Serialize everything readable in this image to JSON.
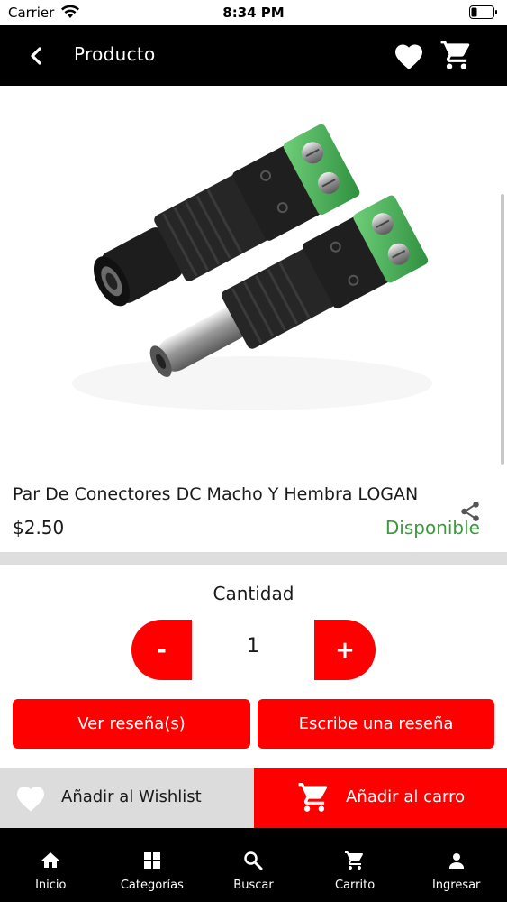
{
  "status_bar": {
    "carrier": "Carrier",
    "time": "8:34 PM"
  },
  "header": {
    "title": "Producto",
    "back_icon": "chevron-left-icon",
    "wishlist_icon": "heart-icon",
    "cart_icon": "cart-icon"
  },
  "product": {
    "name": "Par De Conectores DC Macho Y Hembra LOGAN",
    "price": "$2.50",
    "availability": "Disponible",
    "image_alt": "DC connector pair"
  },
  "quantity": {
    "label": "Cantidad",
    "value": "1",
    "minus_label": "-",
    "plus_label": "+"
  },
  "reviews": {
    "view_label": "Ver reseña(s)",
    "write_label": "Escribe una reseña"
  },
  "actions": {
    "wishlist_label": "Añadir al Wishlist",
    "add_to_cart_label": "Añadir al carro"
  },
  "tabs": [
    {
      "label": "Inicio",
      "icon": "home-icon"
    },
    {
      "label": "Categorías",
      "icon": "grid-icon"
    },
    {
      "label": "Buscar",
      "icon": "search-icon"
    },
    {
      "label": "Carrito",
      "icon": "cart-icon"
    },
    {
      "label": "Ingresar",
      "icon": "person-icon"
    }
  ],
  "colors": {
    "accent": "#ff0000",
    "header_bg": "#000000",
    "available": "#3b9a3b"
  }
}
